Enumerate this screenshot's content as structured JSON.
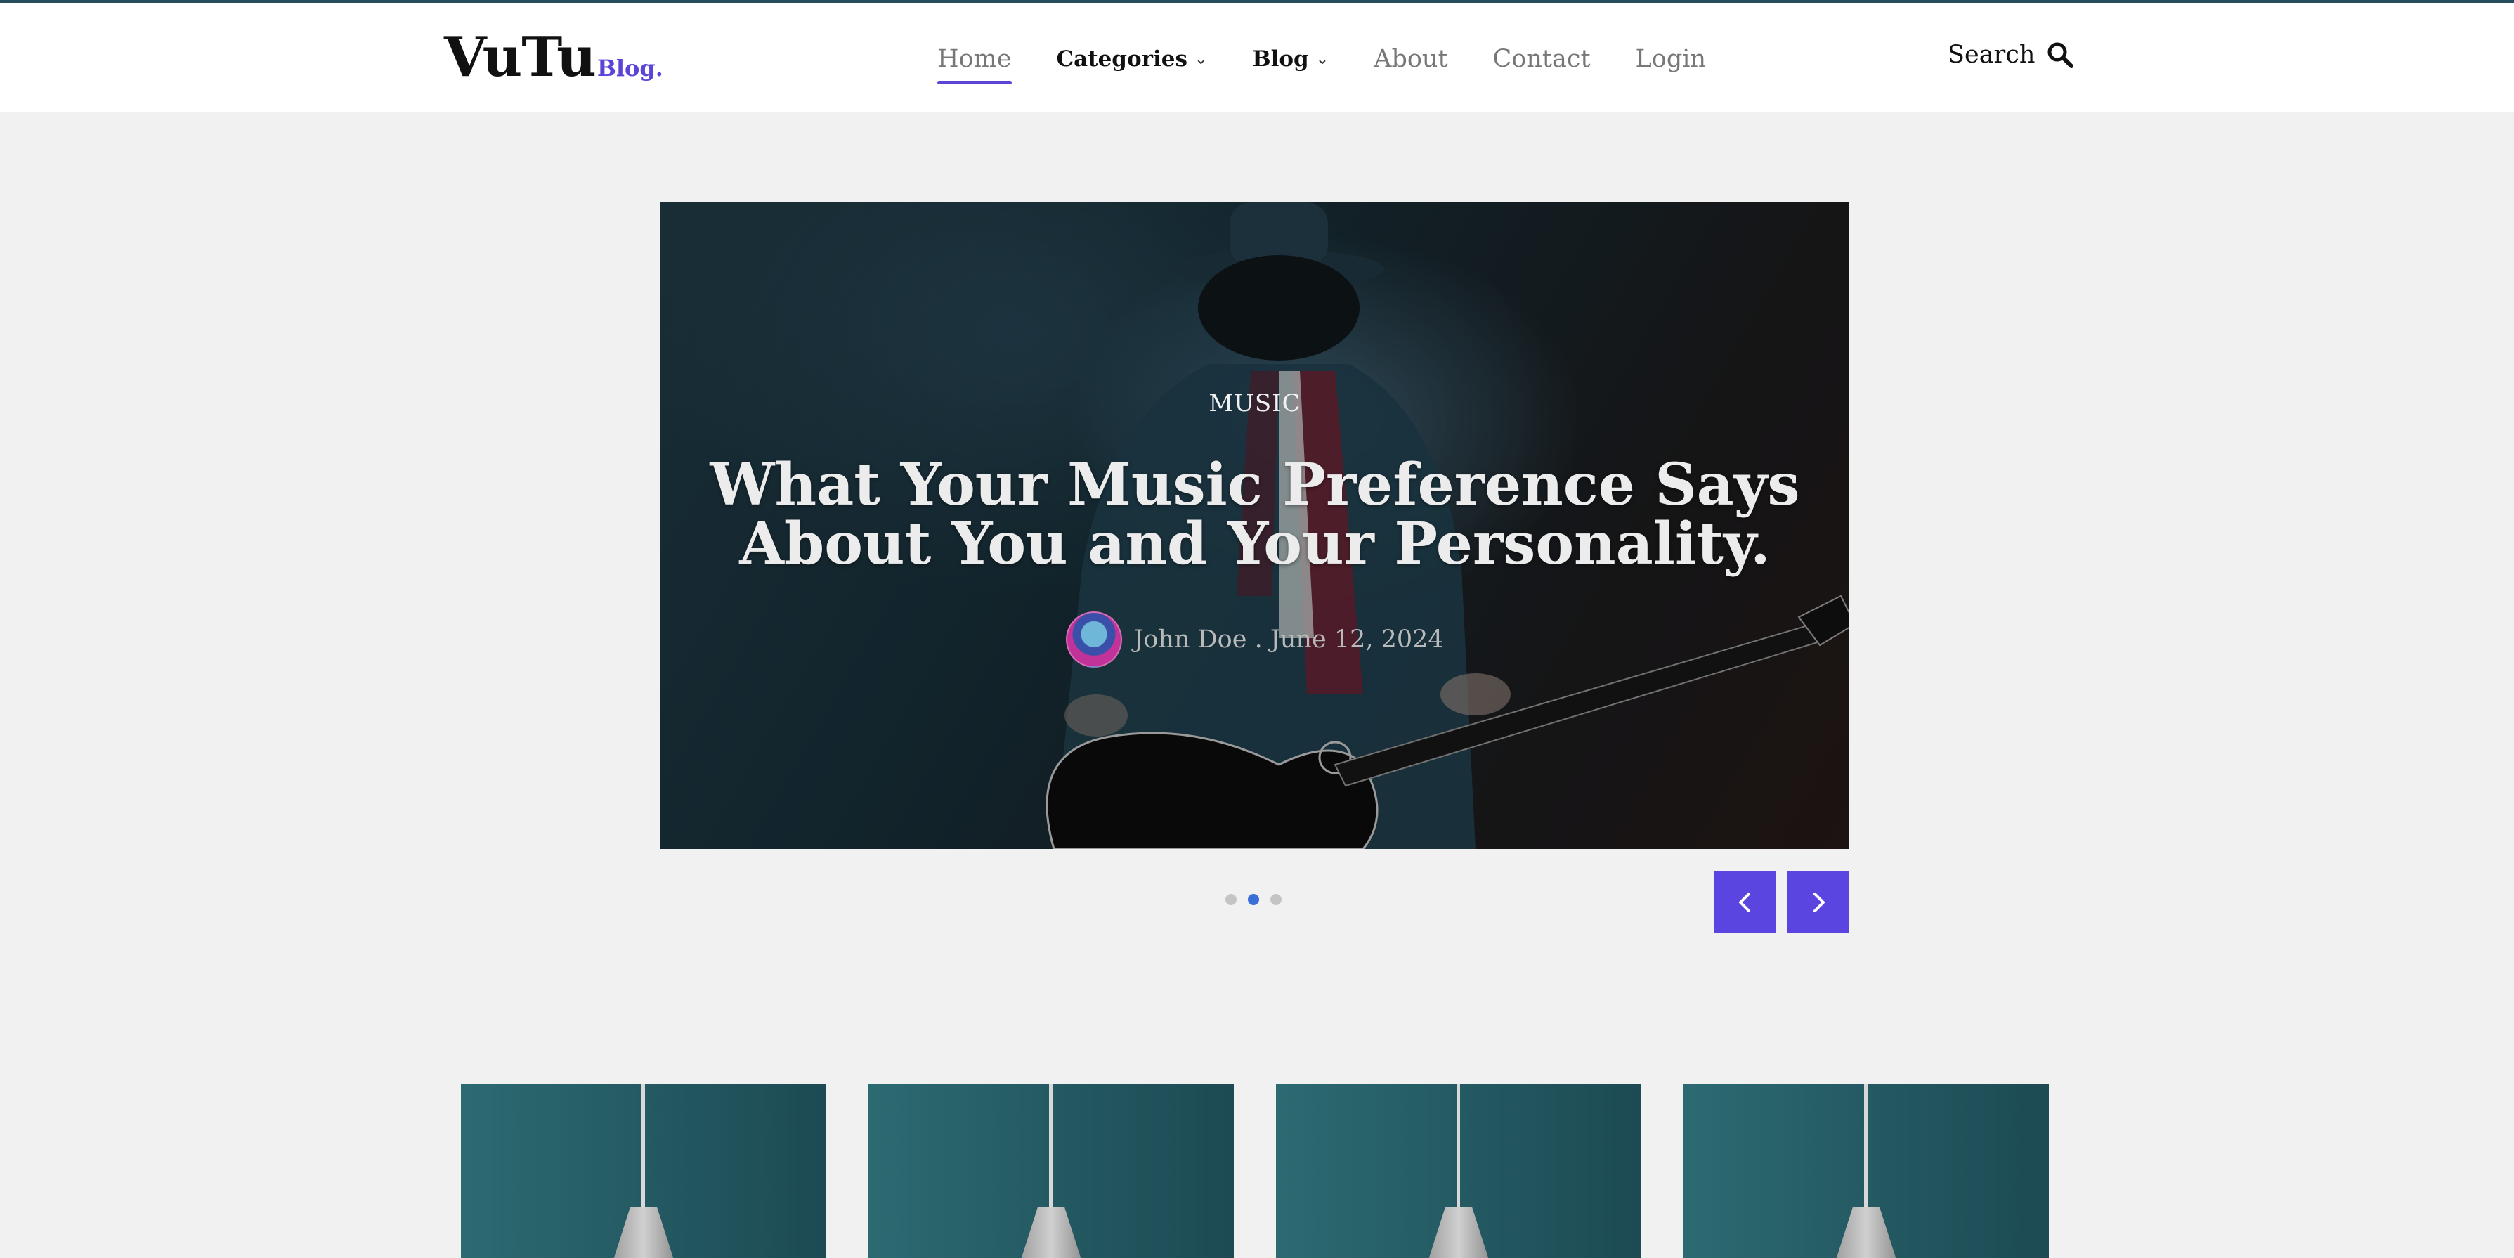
{
  "brand": {
    "name": "VuTu",
    "suffix": "Blog.",
    "accent_color": "#5b45d6"
  },
  "nav": {
    "items": [
      {
        "label": "Home",
        "active": true,
        "has_dropdown": false
      },
      {
        "label": "Categories",
        "active": false,
        "has_dropdown": true
      },
      {
        "label": "Blog",
        "active": false,
        "has_dropdown": true
      },
      {
        "label": "About",
        "active": false,
        "has_dropdown": false
      },
      {
        "label": "Contact",
        "active": false,
        "has_dropdown": false
      },
      {
        "label": "Login",
        "active": false,
        "has_dropdown": false
      }
    ],
    "dropdown_icon": "chevron-down-icon"
  },
  "search": {
    "label": "Search",
    "icon": "search-icon"
  },
  "hero": {
    "category": "MUSIC",
    "title": "What Your Music Preference Says About You and Your Personality.",
    "author": "John Doe",
    "separator": ".",
    "date": "June 12, 2024",
    "meta_text": "John Doe . June 12, 2024"
  },
  "slider": {
    "slide_count": 3,
    "active_index": 1,
    "prev_icon": "chevron-left-icon",
    "next_icon": "chevron-right-icon",
    "button_color": "#5b45e0",
    "active_dot_color": "#3a6fd8"
  },
  "cards": {
    "count": 4,
    "image": "pendant-lamp"
  }
}
